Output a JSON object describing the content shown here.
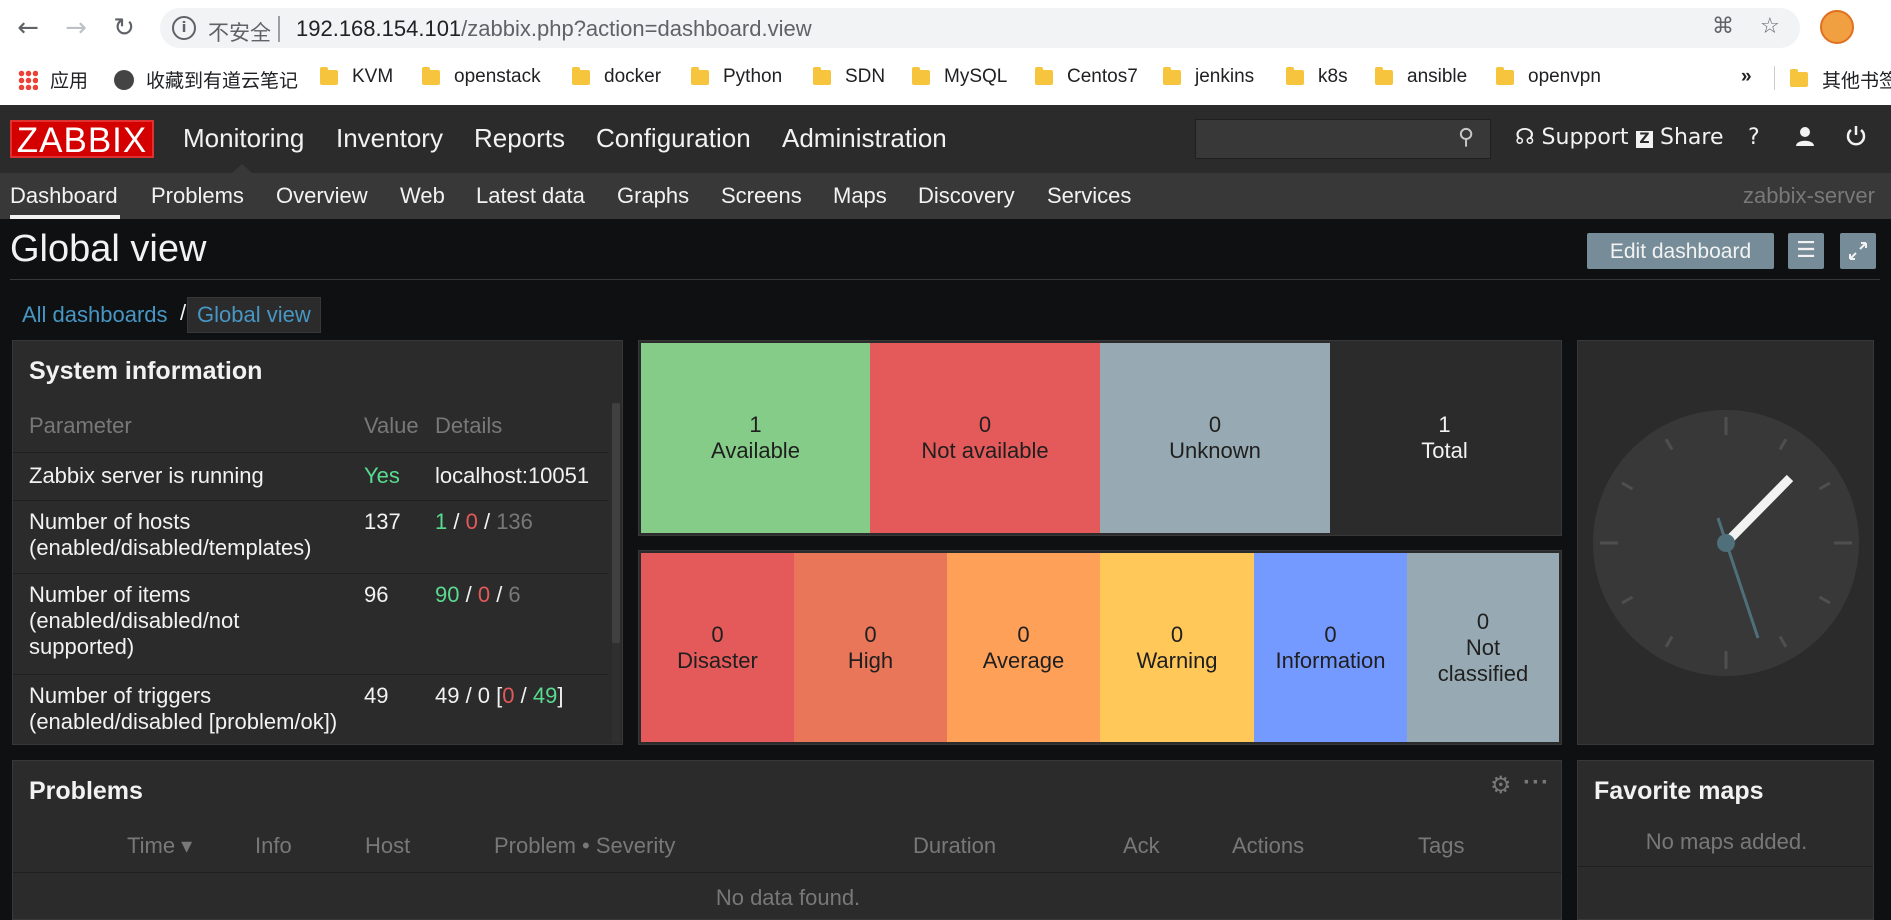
{
  "browser": {
    "insecure_label": "不安全",
    "url_host": "192.168.154.101",
    "url_path": "/zabbix.php?action=dashboard.view",
    "bookmarks": [
      {
        "label": "应用",
        "icon": "apps-grid-icon"
      },
      {
        "label": "收藏到有道云笔记",
        "icon": "youdao-icon"
      },
      {
        "label": "KVM",
        "icon": "folder-icon"
      },
      {
        "label": "openstack",
        "icon": "folder-icon"
      },
      {
        "label": "docker",
        "icon": "folder-icon"
      },
      {
        "label": "Python",
        "icon": "folder-icon"
      },
      {
        "label": "SDN",
        "icon": "folder-icon"
      },
      {
        "label": "MySQL",
        "icon": "folder-icon"
      },
      {
        "label": "Centos7",
        "icon": "folder-icon"
      },
      {
        "label": "jenkins",
        "icon": "folder-icon"
      },
      {
        "label": "k8s",
        "icon": "folder-icon"
      },
      {
        "label": "ansible",
        "icon": "folder-icon"
      },
      {
        "label": "openvpn",
        "icon": "folder-icon"
      }
    ],
    "overflow_label": "»",
    "other_bookmarks": "其他书签"
  },
  "zabbix": {
    "logo": "ZABBIX",
    "main_menu": [
      "Monitoring",
      "Inventory",
      "Reports",
      "Configuration",
      "Administration"
    ],
    "support": "Support",
    "share": "Share",
    "help": "?",
    "sub_menu": [
      "Dashboard",
      "Problems",
      "Overview",
      "Web",
      "Latest data",
      "Graphs",
      "Screens",
      "Maps",
      "Discovery",
      "Services"
    ],
    "server_name": "zabbix-server"
  },
  "page": {
    "title": "Global view",
    "edit_button": "Edit dashboard",
    "breadcrumb_all": "All dashboards",
    "breadcrumb_sep": "/",
    "breadcrumb_current": "Global view"
  },
  "system_info": {
    "title": "System information",
    "headers": [
      "Parameter",
      "Value",
      "Details"
    ],
    "rows": [
      {
        "param": "Zabbix server is running",
        "value": "Yes",
        "details": "localhost:10051"
      },
      {
        "param": "Number of hosts (enabled/disabled/templates)",
        "value": "137",
        "d1": "1",
        "d2": "0",
        "d3": "136"
      },
      {
        "param": "Number of items (enabled/disabled/not supported)",
        "value": "96",
        "d1": "90",
        "d2": "0",
        "d3": "6"
      },
      {
        "param": "Number of triggers (enabled/disabled [problem/ok])",
        "value": "49",
        "d_pre": "49 / 0 [",
        "d1": "0",
        "d2": "49",
        "d_post": "]"
      }
    ]
  },
  "host_availability": [
    {
      "count": "1",
      "label": "Available",
      "color": "#86cc89"
    },
    {
      "count": "0",
      "label": "Not available",
      "color": "#e45959"
    },
    {
      "count": "0",
      "label": "Unknown",
      "color": "#97aab3"
    },
    {
      "count": "1",
      "label": "Total",
      "color": "#2b2b2b"
    }
  ],
  "problems_by_severity": [
    {
      "count": "0",
      "label": "Disaster",
      "color": "#e45959"
    },
    {
      "count": "0",
      "label": "High",
      "color": "#e97659"
    },
    {
      "count": "0",
      "label": "Average",
      "color": "#ffa059"
    },
    {
      "count": "0",
      "label": "Warning",
      "color": "#ffc859"
    },
    {
      "count": "0",
      "label": "Information",
      "color": "#7499ff"
    },
    {
      "count": "0",
      "label": "Not classified",
      "color": "#97aab3"
    }
  ],
  "problems": {
    "title": "Problems",
    "columns": [
      "Time ▾",
      "Info",
      "Host",
      "Problem • Severity",
      "Duration",
      "Ack",
      "Actions",
      "Tags"
    ],
    "empty": "No data found."
  },
  "favorite_maps": {
    "title": "Favorite maps",
    "empty": "No maps added."
  }
}
